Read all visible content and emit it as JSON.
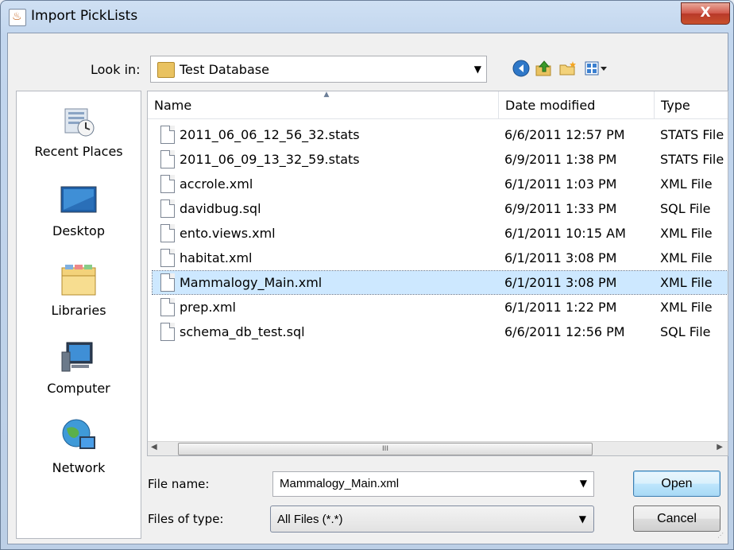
{
  "window": {
    "title": "Import PickLists",
    "close_label": "X"
  },
  "lookin": {
    "label": "Look in:",
    "value": "Test Database"
  },
  "toolbar": {
    "back_icon": "back-icon",
    "up_icon": "up-folder-icon",
    "new_folder_icon": "new-folder-icon",
    "view_icon": "view-menu-icon"
  },
  "places": [
    {
      "label": "Recent Places",
      "icon": "recent-places-icon"
    },
    {
      "label": "Desktop",
      "icon": "desktop-icon"
    },
    {
      "label": "Libraries",
      "icon": "libraries-icon"
    },
    {
      "label": "Computer",
      "icon": "computer-icon"
    },
    {
      "label": "Network",
      "icon": "network-icon"
    }
  ],
  "columns": {
    "name": "Name",
    "date": "Date modified",
    "type": "Type"
  },
  "files": [
    {
      "name": "2011_06_06_12_56_32.stats",
      "date": "6/6/2011 12:57 PM",
      "type": "STATS File"
    },
    {
      "name": "2011_06_09_13_32_59.stats",
      "date": "6/9/2011 1:38 PM",
      "type": "STATS File"
    },
    {
      "name": "accrole.xml",
      "date": "6/1/2011 1:03 PM",
      "type": "XML File"
    },
    {
      "name": "davidbug.sql",
      "date": "6/9/2011 1:33 PM",
      "type": "SQL File"
    },
    {
      "name": "ento.views.xml",
      "date": "6/1/2011 10:15 AM",
      "type": "XML File"
    },
    {
      "name": "habitat.xml",
      "date": "6/1/2011 3:08 PM",
      "type": "XML File"
    },
    {
      "name": "Mammalogy_Main.xml",
      "date": "6/1/2011 3:08 PM",
      "type": "XML File"
    },
    {
      "name": "prep.xml",
      "date": "6/1/2011 1:22 PM",
      "type": "XML File"
    },
    {
      "name": "schema_db_test.sql",
      "date": "6/6/2011 12:56 PM",
      "type": "SQL File"
    }
  ],
  "selected_index": 6,
  "scrollbar": {
    "thumb_grip": "III"
  },
  "filename": {
    "label": "File name:",
    "value": "Mammalogy_Main.xml"
  },
  "filetype": {
    "label": "Files of type:",
    "value": "All Files (*.*)"
  },
  "buttons": {
    "open": "Open",
    "cancel": "Cancel"
  }
}
